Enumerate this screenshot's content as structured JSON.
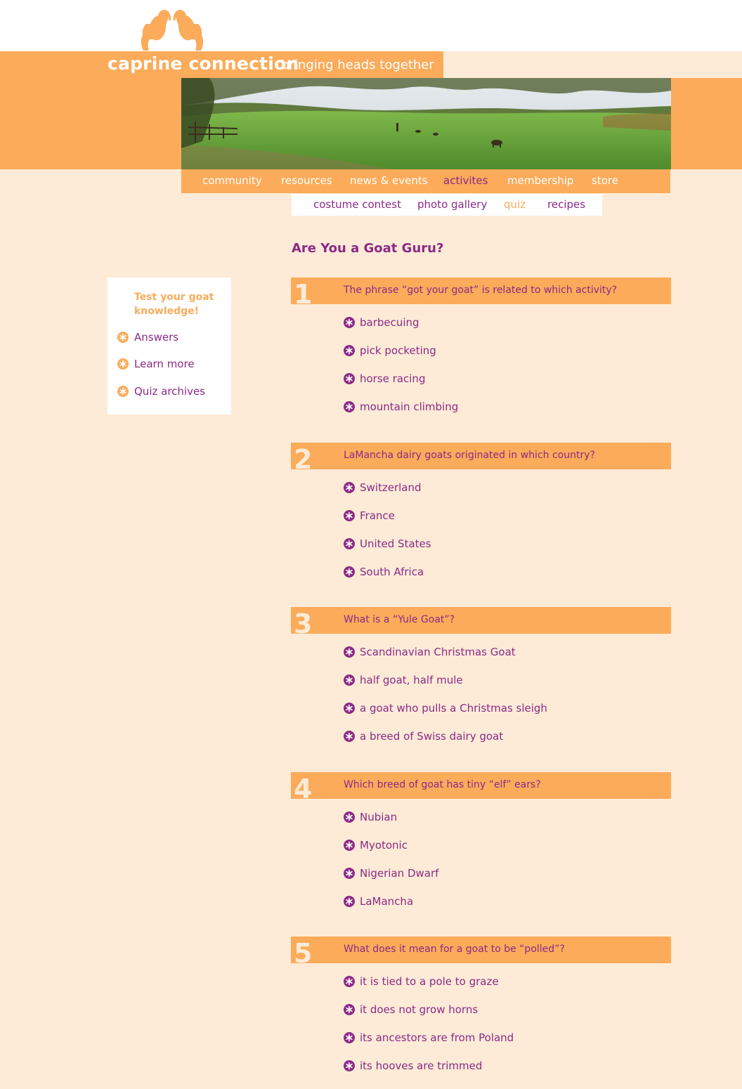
{
  "brand": {
    "name": "caprine connection",
    "tagline": "bringing heads together"
  },
  "colors": {
    "orange": "#fbab5a",
    "purple": "#8b2a86",
    "cream": "#fdebd7"
  },
  "main_nav": [
    {
      "label": "community",
      "active": false
    },
    {
      "label": "resources",
      "active": false
    },
    {
      "label": "news & events",
      "active": false
    },
    {
      "label": "activites",
      "active": true
    },
    {
      "label": "membership",
      "active": false
    },
    {
      "label": "store",
      "active": false
    }
  ],
  "sub_nav": [
    {
      "label": "costume contest",
      "active": false
    },
    {
      "label": "photo gallery",
      "active": false
    },
    {
      "label": "quiz",
      "active": true
    },
    {
      "label": "recipes",
      "active": false
    }
  ],
  "page_title": "Are You a Goat Guru?",
  "sidebar": {
    "heading": "Test your goat knowledge!",
    "links": [
      "Answers",
      "Learn more",
      "Quiz archives"
    ]
  },
  "questions": [
    {
      "number": "1",
      "text": "The phrase “got your goat” is related to which activity?",
      "options": [
        "barbecuing",
        "pick pocketing",
        "horse racing",
        "mountain climbing"
      ]
    },
    {
      "number": "2",
      "text": "LaMancha dairy goats originated in which country?",
      "options": [
        "Switzerland",
        "France",
        "United States",
        "South Africa"
      ]
    },
    {
      "number": "3",
      "text": "What is a “Yule Goat”?",
      "options": [
        "Scandinavian Christmas Goat",
        "half goat, half mule",
        "a goat who pulls a Christmas sleigh",
        "a breed of Swiss dairy goat"
      ]
    },
    {
      "number": "4",
      "text": "Which breed of goat has tiny “elf” ears?",
      "options": [
        "Nubian",
        "Myotonic",
        "Nigerian Dwarf",
        "LaMancha"
      ]
    },
    {
      "number": "5",
      "text": "What does it mean for a goat to be “polled”?",
      "options": [
        "it is tied to a pole to graze",
        "it does not grow horns",
        "its ancestors are from Poland",
        "its hooves are trimmed"
      ]
    }
  ]
}
